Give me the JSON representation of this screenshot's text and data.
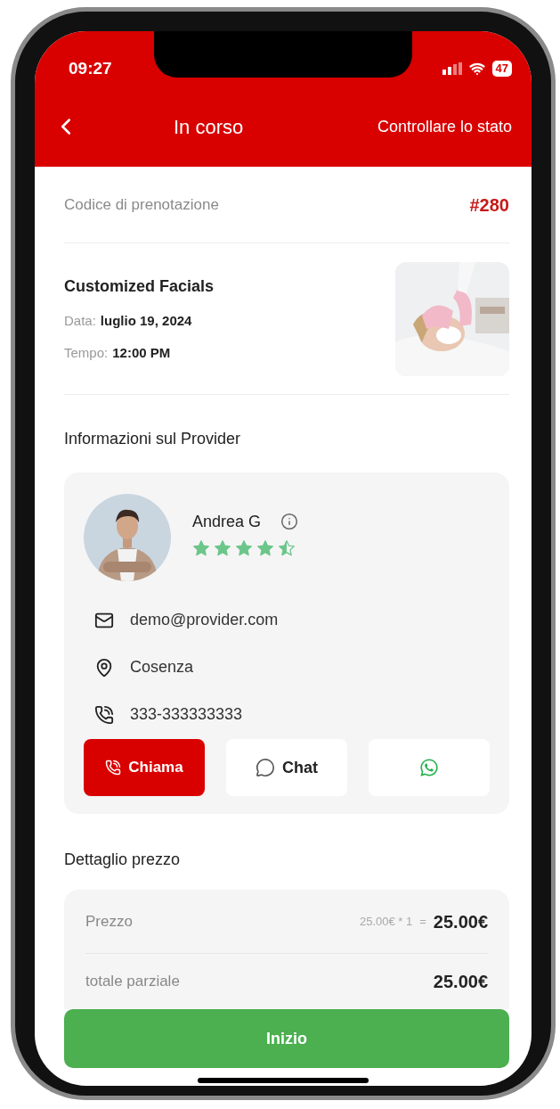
{
  "status_bar": {
    "time": "09:27",
    "battery": "47"
  },
  "header": {
    "title": "In corso",
    "action": "Controllare lo stato"
  },
  "booking": {
    "label": "Codice di prenotazione",
    "code": "#280"
  },
  "service": {
    "name": "Customized Facials",
    "fields": [
      {
        "label": "Data:",
        "value": "luglio 19, 2024"
      },
      {
        "label": "Tempo:",
        "value": "12:00 PM"
      }
    ]
  },
  "provider_section": {
    "title": "Informazioni sul Provider"
  },
  "provider": {
    "name": "Andrea G",
    "stars": 4.5,
    "contacts": [
      {
        "kind": "email",
        "text": "demo@provider.com"
      },
      {
        "kind": "location",
        "text": "Cosenza"
      },
      {
        "kind": "phone",
        "text": "333-333333333"
      }
    ],
    "actions": [
      {
        "kind": "call",
        "label": "Chiama"
      },
      {
        "kind": "chat",
        "label": "Chat"
      },
      {
        "kind": "whatsapp"
      }
    ]
  },
  "price_section": {
    "title": "Dettaglio prezzo"
  },
  "price_rows": [
    {
      "label": "Prezzo",
      "calc": "25.00€ * 1",
      "equals": "=",
      "amount": "25.00€"
    },
    {
      "label": "totale parziale",
      "amount": "25.00€"
    }
  ],
  "primary_button": {
    "label": "Inizio"
  }
}
